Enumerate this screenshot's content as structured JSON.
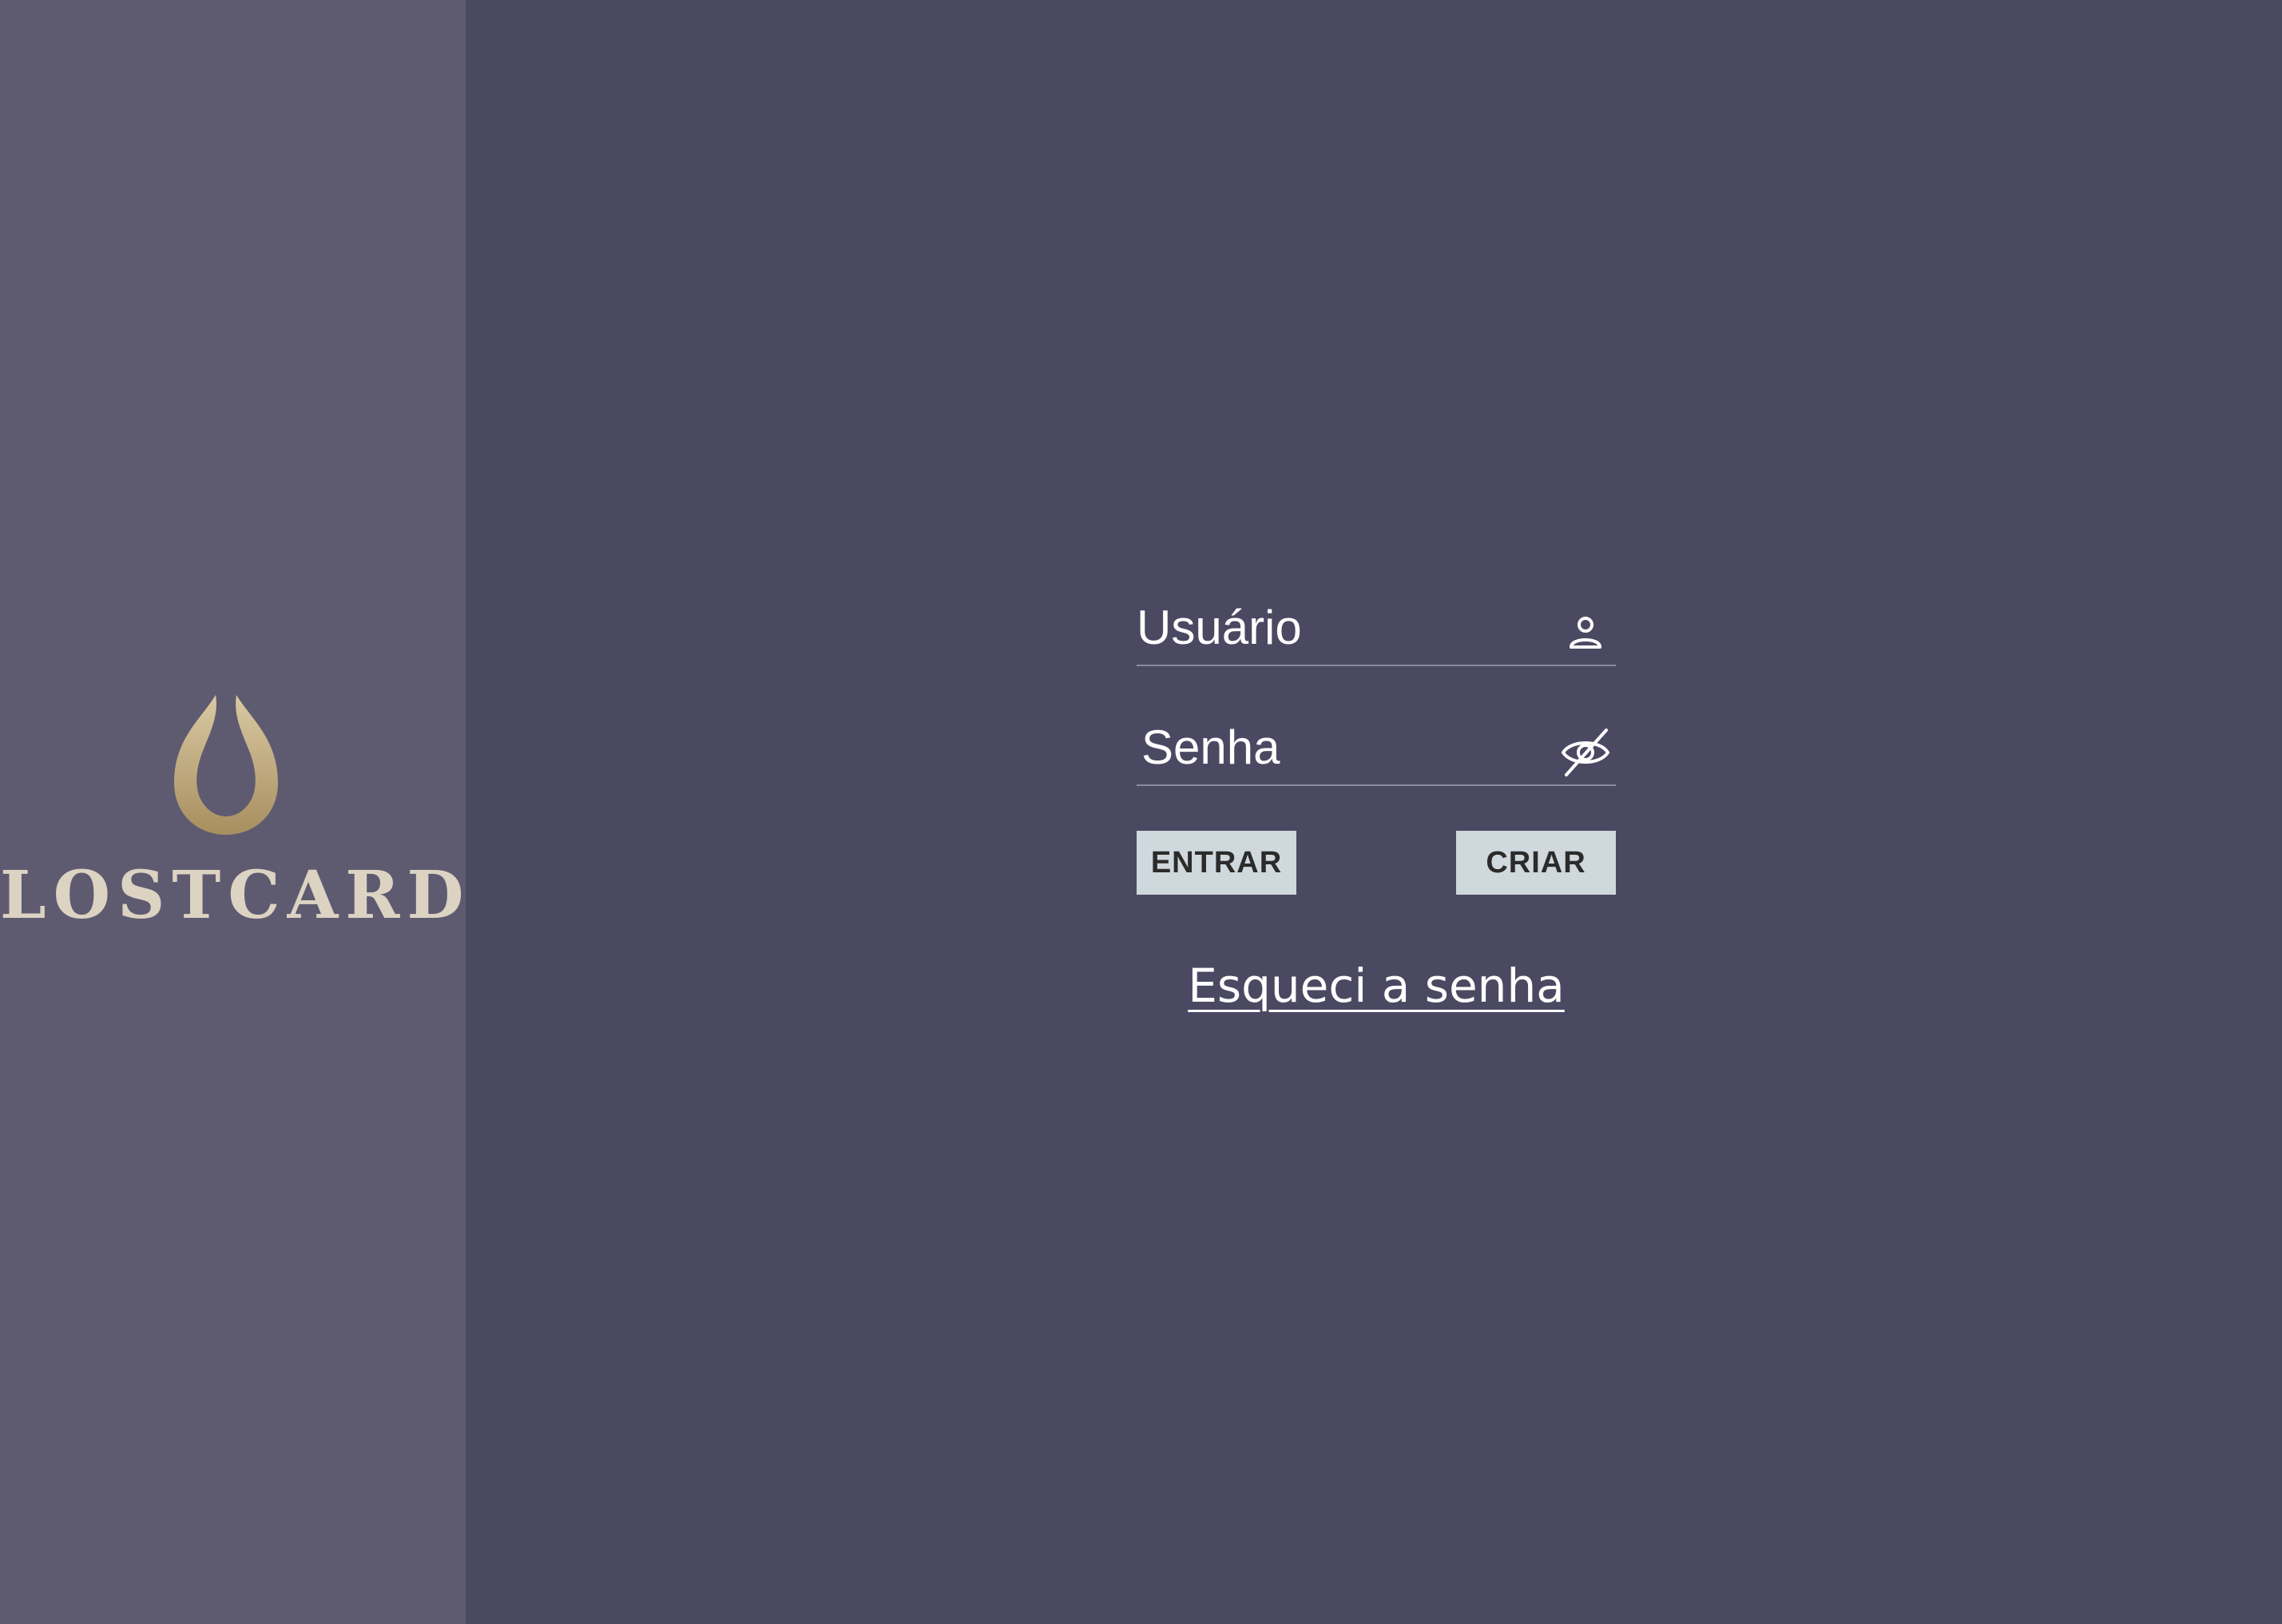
{
  "brand": {
    "name": "LOSTCARDS",
    "logo_icon": "flame-drop-logo-icon",
    "logo_color": "#b39a6c",
    "wordmark_color": "#dcd3c3"
  },
  "login": {
    "username_placeholder": "Usuário",
    "username_icon": "user-icon",
    "password_placeholder": "Senha",
    "password_icon": "eye-off-icon",
    "enter_label": "ENTRAR",
    "create_label": "CRIAR",
    "forgot_label": "Esqueci a senha"
  },
  "colors": {
    "sidebar_bg": "#5e5b71",
    "main_bg": "#4b4962",
    "button_bg": "#cfd8dc"
  }
}
